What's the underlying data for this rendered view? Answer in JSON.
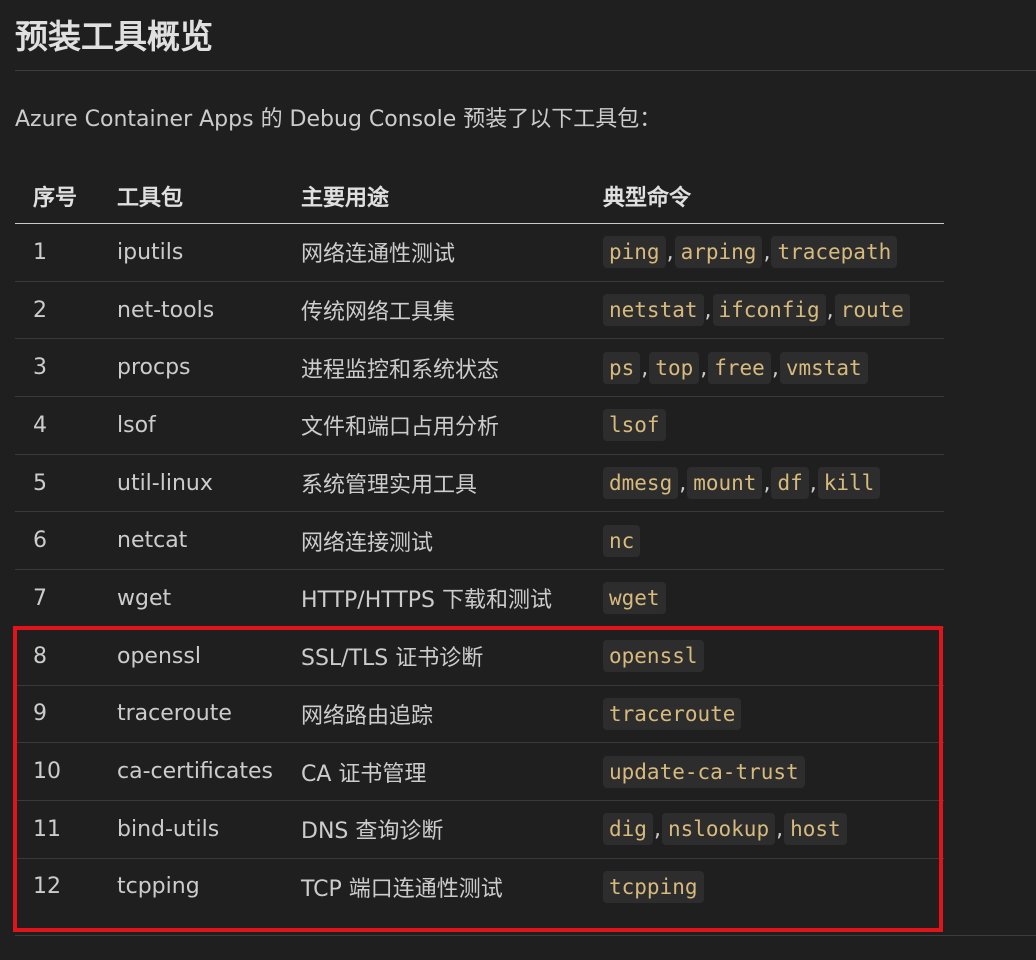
{
  "heading": "预装工具概览",
  "intro": "Azure Container Apps 的 Debug Console 预装了以下工具包：",
  "table": {
    "headers": [
      "序号",
      "工具包",
      "主要用途",
      "典型命令"
    ],
    "rows": [
      {
        "num": "1",
        "tool": "iputils",
        "use": "网络连通性测试",
        "commands": [
          "ping",
          "arping",
          "tracepath"
        ]
      },
      {
        "num": "2",
        "tool": "net-tools",
        "use": "传统网络工具集",
        "commands": [
          "netstat",
          "ifconfig",
          "route"
        ]
      },
      {
        "num": "3",
        "tool": "procps",
        "use": "进程监控和系统状态",
        "commands": [
          "ps",
          "top",
          "free",
          "vmstat"
        ]
      },
      {
        "num": "4",
        "tool": "lsof",
        "use": "文件和端口占用分析",
        "commands": [
          "lsof"
        ]
      },
      {
        "num": "5",
        "tool": "util-linux",
        "use": "系统管理实用工具",
        "commands": [
          "dmesg",
          "mount",
          "df",
          "kill"
        ]
      },
      {
        "num": "6",
        "tool": "netcat",
        "use": "网络连接测试",
        "commands": [
          "nc"
        ]
      },
      {
        "num": "7",
        "tool": "wget",
        "use": "HTTP/HTTPS 下载和测试",
        "commands": [
          "wget"
        ]
      },
      {
        "num": "8",
        "tool": "openssl",
        "use": "SSL/TLS 证书诊断",
        "commands": [
          "openssl"
        ]
      },
      {
        "num": "9",
        "tool": "traceroute",
        "use": "网络路由追踪",
        "commands": [
          "traceroute"
        ]
      },
      {
        "num": "10",
        "tool": "ca-certificates",
        "use": "CA 证书管理",
        "commands": [
          "update-ca-trust"
        ]
      },
      {
        "num": "11",
        "tool": "bind-utils",
        "use": "DNS 查询诊断",
        "commands": [
          "dig",
          "nslookup",
          "host"
        ]
      },
      {
        "num": "12",
        "tool": "tcpping",
        "use": "TCP 端口连通性测试",
        "commands": [
          "tcpping"
        ]
      }
    ]
  },
  "colors": {
    "background": "#1f1f1f",
    "text": "#cccccc",
    "code_text": "#d7ba7d",
    "code_bg": "#2d2d2d",
    "highlight_border": "#e0141b"
  }
}
